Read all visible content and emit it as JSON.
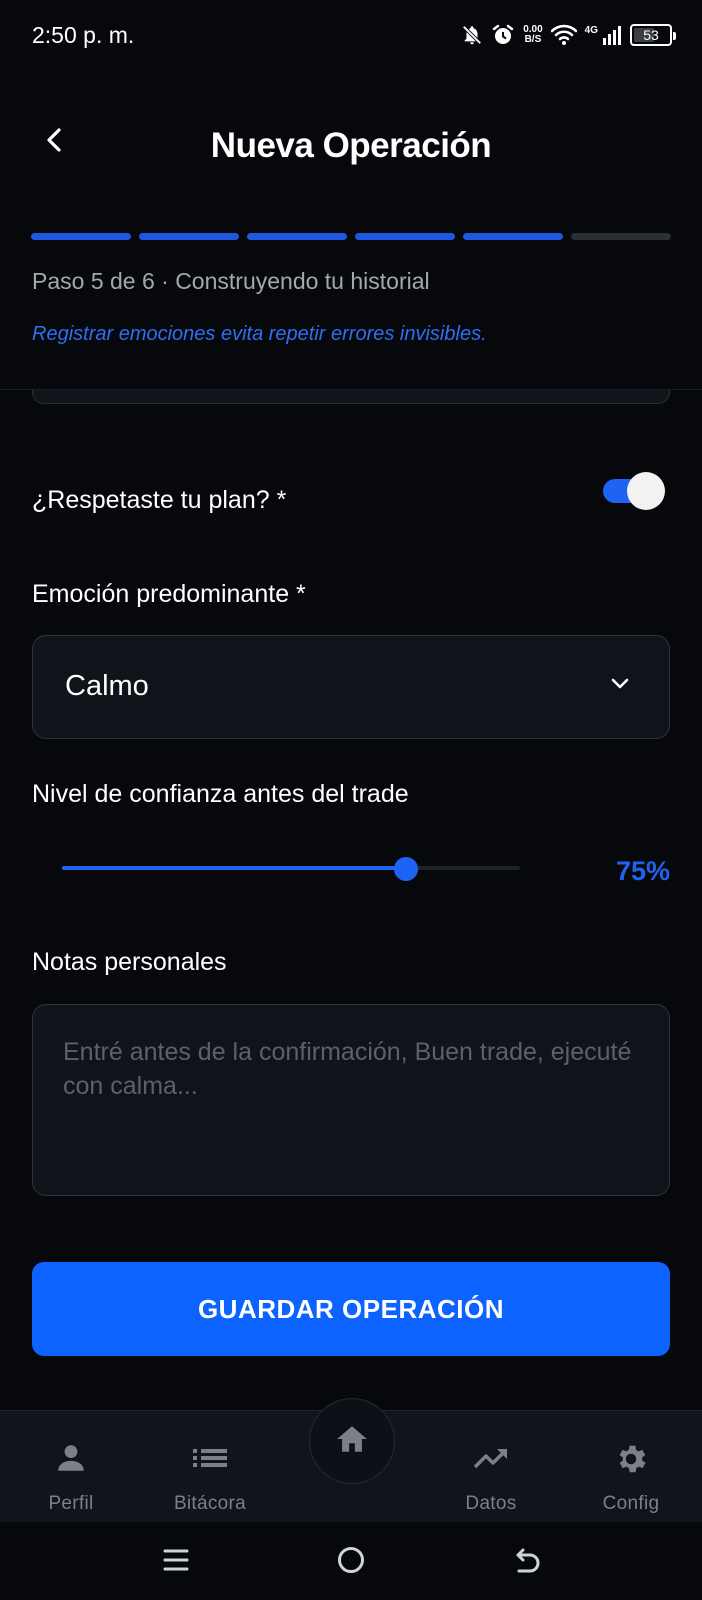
{
  "status_bar": {
    "time": "2:50 p. m.",
    "net_speed_value": "0.00",
    "net_speed_unit": "B/S",
    "network_type": "4G",
    "battery": "53",
    "icons": [
      "bell-off-icon",
      "alarm-icon",
      "wifi-icon",
      "signal-icon",
      "battery-icon"
    ]
  },
  "header": {
    "title": "Nueva Operación",
    "back_icon": "chevron-left-icon",
    "progress": {
      "current_step": 5,
      "total_steps": 6
    },
    "step_text": "Paso 5 de 6 · Construyendo tu historial",
    "tip_text": "Registrar emociones evita repetir errores invisibles."
  },
  "form": {
    "plan_label": "¿Respetaste tu plan? *",
    "plan_followed": true,
    "emotion_label": "Emoción predominante *",
    "emotion_value": "Calmo",
    "confidence_label": "Nivel de confianza antes del trade",
    "confidence_value": 75,
    "confidence_text": "75%",
    "notes_label": "Notas personales",
    "notes_placeholder": "Entré antes de la confirmación, Buen trade, ejecuté con calma...",
    "save_label": "GUARDAR OPERACIÓN"
  },
  "colors": {
    "accent": "#0c63ff",
    "background": "#06080b",
    "surface": "#10131a",
    "muted_text": "#a4a8ae"
  },
  "bottom_nav": {
    "items": [
      {
        "label": "Perfil",
        "icon": "person-icon"
      },
      {
        "label": "Bitácora",
        "icon": "list-icon"
      },
      {
        "label": "Datos",
        "icon": "trending-up-icon"
      },
      {
        "label": "Config",
        "icon": "gear-icon"
      }
    ],
    "home_icon": "home-icon"
  },
  "system_nav": {
    "icons": [
      "menu-icon",
      "home-circle-icon",
      "back-arrow-icon"
    ]
  }
}
